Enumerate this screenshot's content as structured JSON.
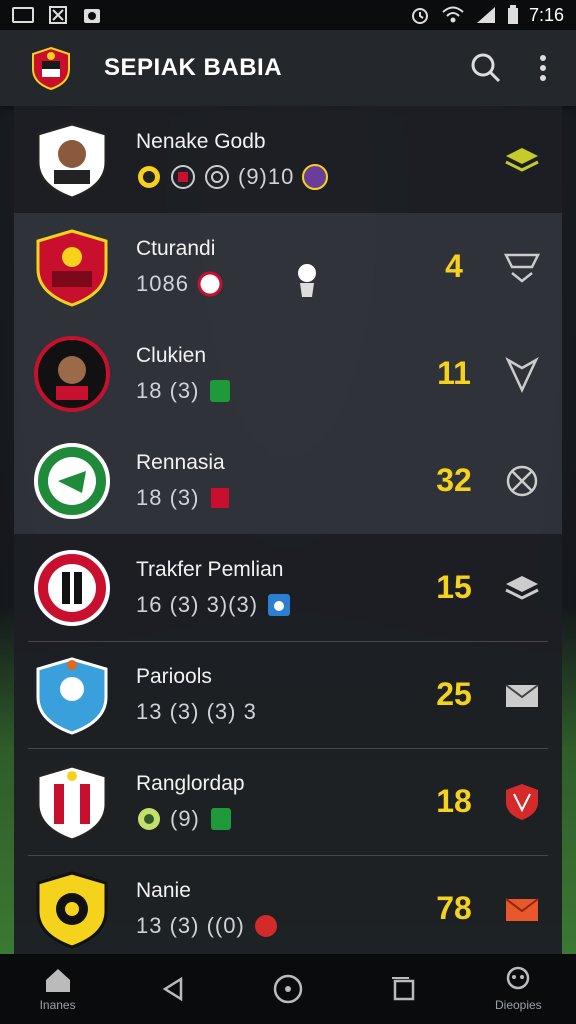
{
  "status": {
    "time": "7:16"
  },
  "app": {
    "title": "SEPIAK BABIA"
  },
  "rows": [
    {
      "name": "Nenake Godb",
      "meta": "(9)10",
      "score": ""
    },
    {
      "name": "Cturandi",
      "meta": "1086",
      "score": "4"
    },
    {
      "name": "Clukien",
      "meta": "18 (3)",
      "score": "11"
    },
    {
      "name": "Rennasia",
      "meta": "18 (3)",
      "score": "32"
    },
    {
      "name": "Trakfer Pemlian",
      "meta": "16 (3) 3)(3)",
      "score": "15"
    },
    {
      "name": "Pariools",
      "meta": "13 (3) (3) 3",
      "score": "25"
    },
    {
      "name": "Ranglordap",
      "meta": "(9)",
      "score": "18"
    },
    {
      "name": "Nanie",
      "meta": "13 (3) ((0)",
      "score": "78"
    }
  ],
  "nav": {
    "home_label": "Inanes",
    "profile_label": "Dieopies"
  },
  "colors": {
    "accent": "#f5d21c",
    "appbar": "#24272c"
  }
}
